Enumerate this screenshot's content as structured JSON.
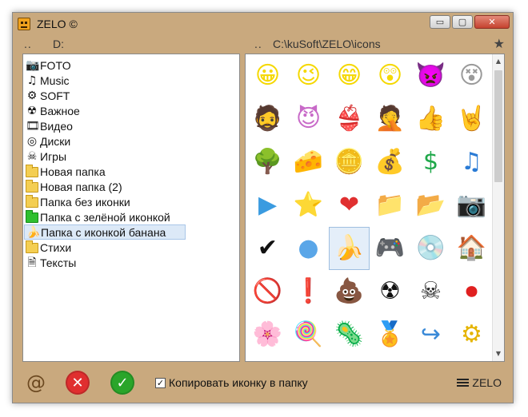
{
  "window": {
    "title": "ZELO ©"
  },
  "controls": {
    "minimize": "▭",
    "maximize": "▢",
    "close": "✕"
  },
  "left_pane": {
    "up": "..",
    "path": "D:"
  },
  "right_pane": {
    "up": "..",
    "path": "C:\\kuSoft\\ZELO\\icons",
    "favorite": "★"
  },
  "folders": [
    {
      "label": "FOTO",
      "icon": "📷"
    },
    {
      "label": "Music",
      "icon": "♫"
    },
    {
      "label": "SOFT",
      "icon": "⚙"
    },
    {
      "label": "Важное",
      "icon": "☢"
    },
    {
      "label": "Видео",
      "icon": "🎞"
    },
    {
      "label": "Диски",
      "icon": "◎"
    },
    {
      "label": "Игры",
      "icon": "☠"
    },
    {
      "label": "Новая папка",
      "icon": "folder"
    },
    {
      "label": "Новая папка (2)",
      "icon": "folder"
    },
    {
      "label": "Папка без иконки",
      "icon": "folder"
    },
    {
      "label": "Папка с зелёной иконкой",
      "icon": "folder-green"
    },
    {
      "label": "Папка с иконкой банана",
      "icon": "🍌"
    },
    {
      "label": "Стихи",
      "icon": "folder"
    },
    {
      "label": "Тексты",
      "icon": "🗎"
    }
  ],
  "icons": [
    {
      "name": "smiley",
      "glyph": "😀",
      "color": "#f5d800"
    },
    {
      "name": "wink",
      "glyph": "😉",
      "color": "#f5d800"
    },
    {
      "name": "grin",
      "glyph": "😁",
      "color": "#f5d800"
    },
    {
      "name": "shocked",
      "glyph": "😲",
      "color": "#f5d800"
    },
    {
      "name": "angry",
      "glyph": "👿",
      "color": "#d81d1d"
    },
    {
      "name": "dead",
      "glyph": "😵",
      "color": "#9a9a9a"
    },
    {
      "name": "bearded",
      "glyph": "🧔",
      "color": "#222222"
    },
    {
      "name": "punk",
      "glyph": "😈",
      "color": "#c86ac8"
    },
    {
      "name": "bikini",
      "glyph": "👙",
      "color": "#e5b400"
    },
    {
      "name": "facepalm",
      "glyph": "🤦",
      "color": "#e5b400"
    },
    {
      "name": "thumbs-up",
      "glyph": "👍",
      "color": "#333333"
    },
    {
      "name": "rock-hand",
      "glyph": "🤘",
      "color": "#333333"
    },
    {
      "name": "tree",
      "glyph": "🌳",
      "color": "#2f8a2f"
    },
    {
      "name": "cheese",
      "glyph": "🧀",
      "color": "#f2c400"
    },
    {
      "name": "coin",
      "glyph": "🪙",
      "color": "#e5b400"
    },
    {
      "name": "money-bag",
      "glyph": "💰",
      "color": "#e5b400"
    },
    {
      "name": "dollar",
      "glyph": "$",
      "color": "#1fa84a"
    },
    {
      "name": "music-note",
      "glyph": "♫",
      "color": "#2a7bd5"
    },
    {
      "name": "play",
      "glyph": "▶",
      "color": "#3a9be0"
    },
    {
      "name": "star",
      "glyph": "⭐",
      "color": "#f5c400"
    },
    {
      "name": "heart",
      "glyph": "❤",
      "color": "#e03030"
    },
    {
      "name": "green-folder",
      "glyph": "📁",
      "color": "#2fbf2f"
    },
    {
      "name": "pink-folder",
      "glyph": "📂",
      "color": "#f0a8d8"
    },
    {
      "name": "camera",
      "glyph": "📷",
      "color": "#555555"
    },
    {
      "name": "checkmark",
      "glyph": "✔",
      "color": "#111111"
    },
    {
      "name": "blue-circle",
      "glyph": "●",
      "color": "#5aa6e8"
    },
    {
      "name": "banana",
      "glyph": "🍌",
      "color": "#f0c400"
    },
    {
      "name": "gamepad",
      "glyph": "🎮",
      "color": "#b8c7d8"
    },
    {
      "name": "disc",
      "glyph": "💿",
      "color": "#bbbbbb"
    },
    {
      "name": "home",
      "glyph": "🏠",
      "color": "#e06a2a"
    },
    {
      "name": "forbidden",
      "glyph": "🚫",
      "color": "#d82020"
    },
    {
      "name": "warning",
      "glyph": "❗",
      "color": "#f5c400"
    },
    {
      "name": "poop",
      "glyph": "💩",
      "color": "#8a3a1a"
    },
    {
      "name": "radioactive",
      "glyph": "☢",
      "color": "#111111"
    },
    {
      "name": "skull",
      "glyph": "☠",
      "color": "#222222"
    },
    {
      "name": "record",
      "glyph": "⏺",
      "color": "#e02020"
    },
    {
      "name": "flower",
      "glyph": "🌸",
      "color": "#b07ae0"
    },
    {
      "name": "candy-cane",
      "glyph": "🍭",
      "color": "#c8702a"
    },
    {
      "name": "bacteria",
      "glyph": "🦠",
      "color": "#5aa6c8"
    },
    {
      "name": "medal",
      "glyph": "🏅",
      "color": "#3a9a3a"
    },
    {
      "name": "redo-arrow",
      "glyph": "↪",
      "color": "#3a8ad8"
    },
    {
      "name": "gear",
      "glyph": "⚙",
      "color": "#e5b400"
    }
  ],
  "selected_icon": "banana",
  "footer": {
    "spiral": "@",
    "cancel": "✕",
    "ok": "✓",
    "copy_label": "Копировать иконку в папку",
    "copy_checked": "✓",
    "menu_label": "ZELO"
  }
}
